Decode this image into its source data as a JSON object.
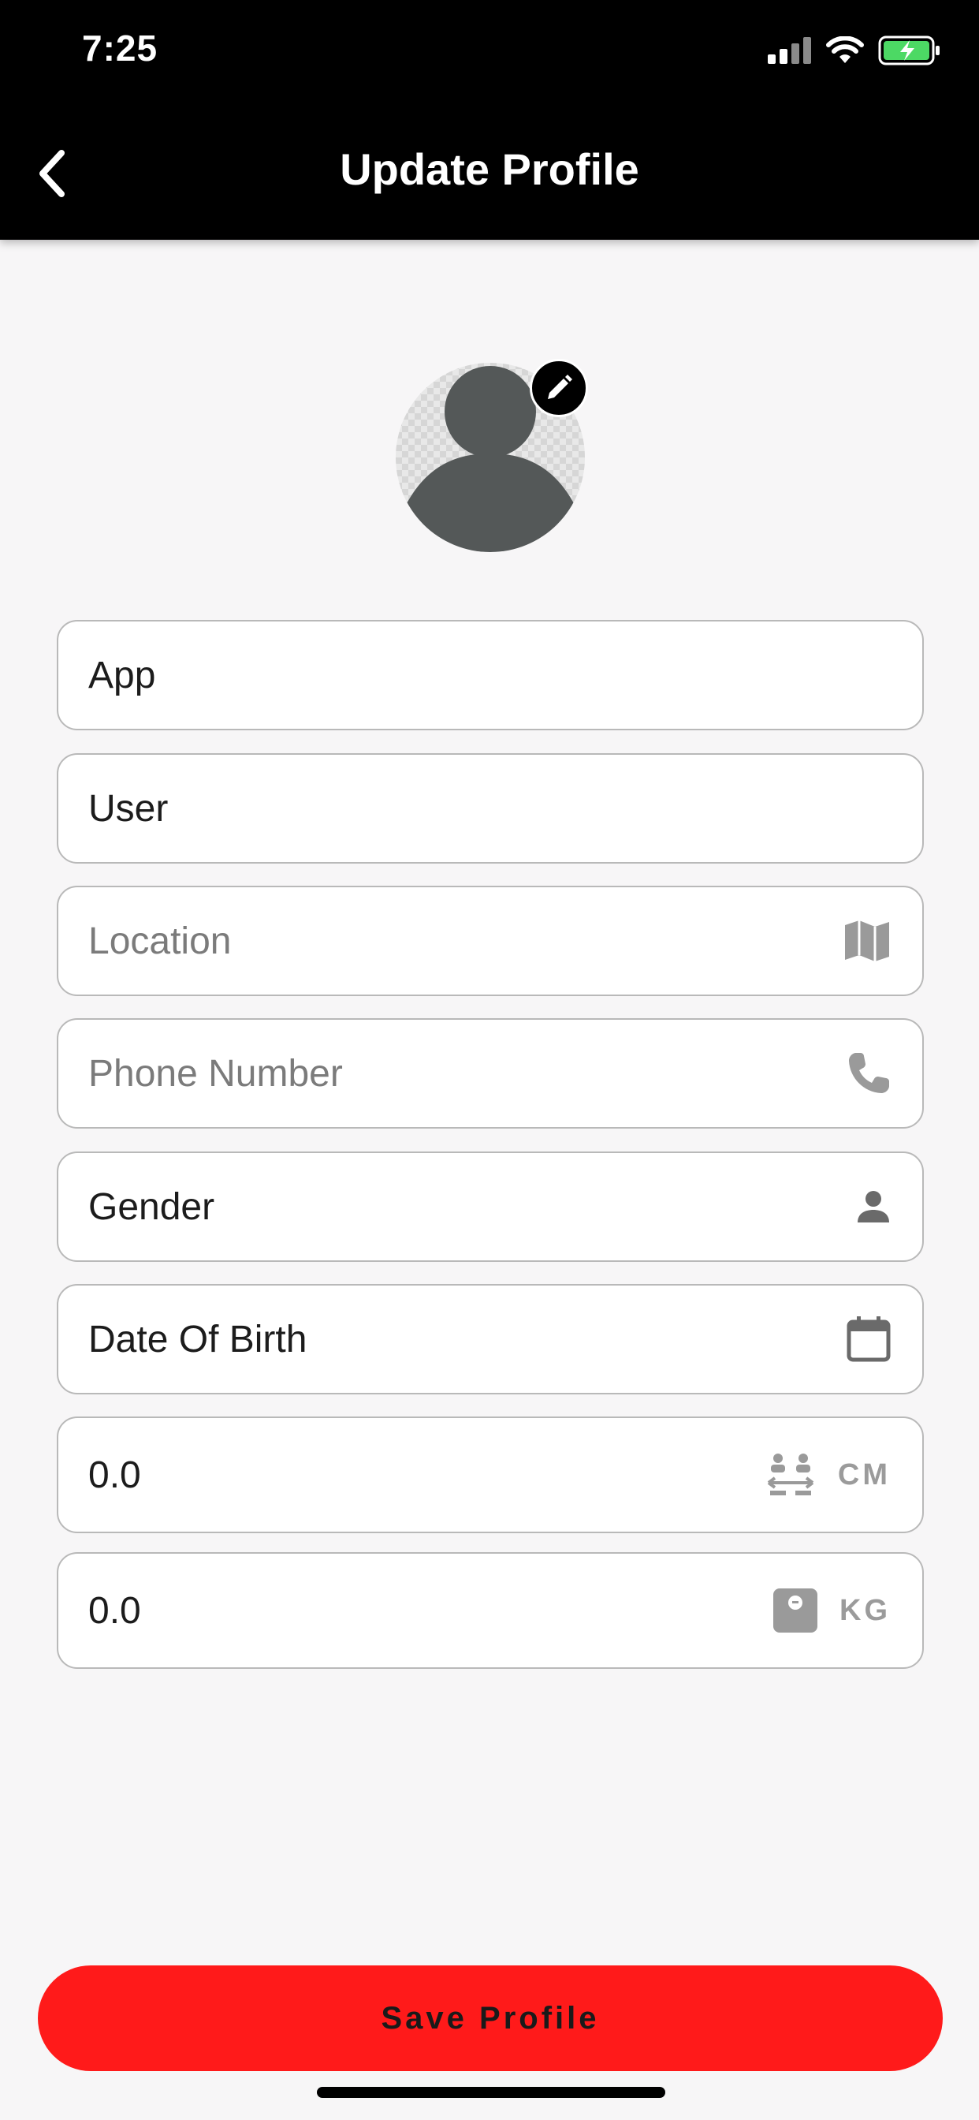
{
  "status_bar": {
    "time": "7:25"
  },
  "header": {
    "title": "Update Profile"
  },
  "form": {
    "first_name": {
      "value": "App"
    },
    "last_name": {
      "value": "User"
    },
    "location": {
      "placeholder": "Location"
    },
    "phone": {
      "placeholder": "Phone Number"
    },
    "gender": {
      "value": "Gender"
    },
    "dob": {
      "value": "Date Of Birth"
    },
    "height": {
      "value": "0.0",
      "unit": "CM"
    },
    "weight": {
      "value": "0.0",
      "unit": "KG"
    }
  },
  "actions": {
    "save_label": "Save Profile"
  },
  "colors": {
    "accent": "#ff1a1a",
    "header_bg": "#000000",
    "battery_green": "#4cd964"
  },
  "icons": [
    "back-chevron-icon",
    "signal-icon",
    "wifi-icon",
    "battery-icon",
    "pencil-icon",
    "map-icon",
    "phone-icon",
    "person-icon",
    "calendar-icon",
    "height-icon",
    "weight-scale-icon"
  ]
}
